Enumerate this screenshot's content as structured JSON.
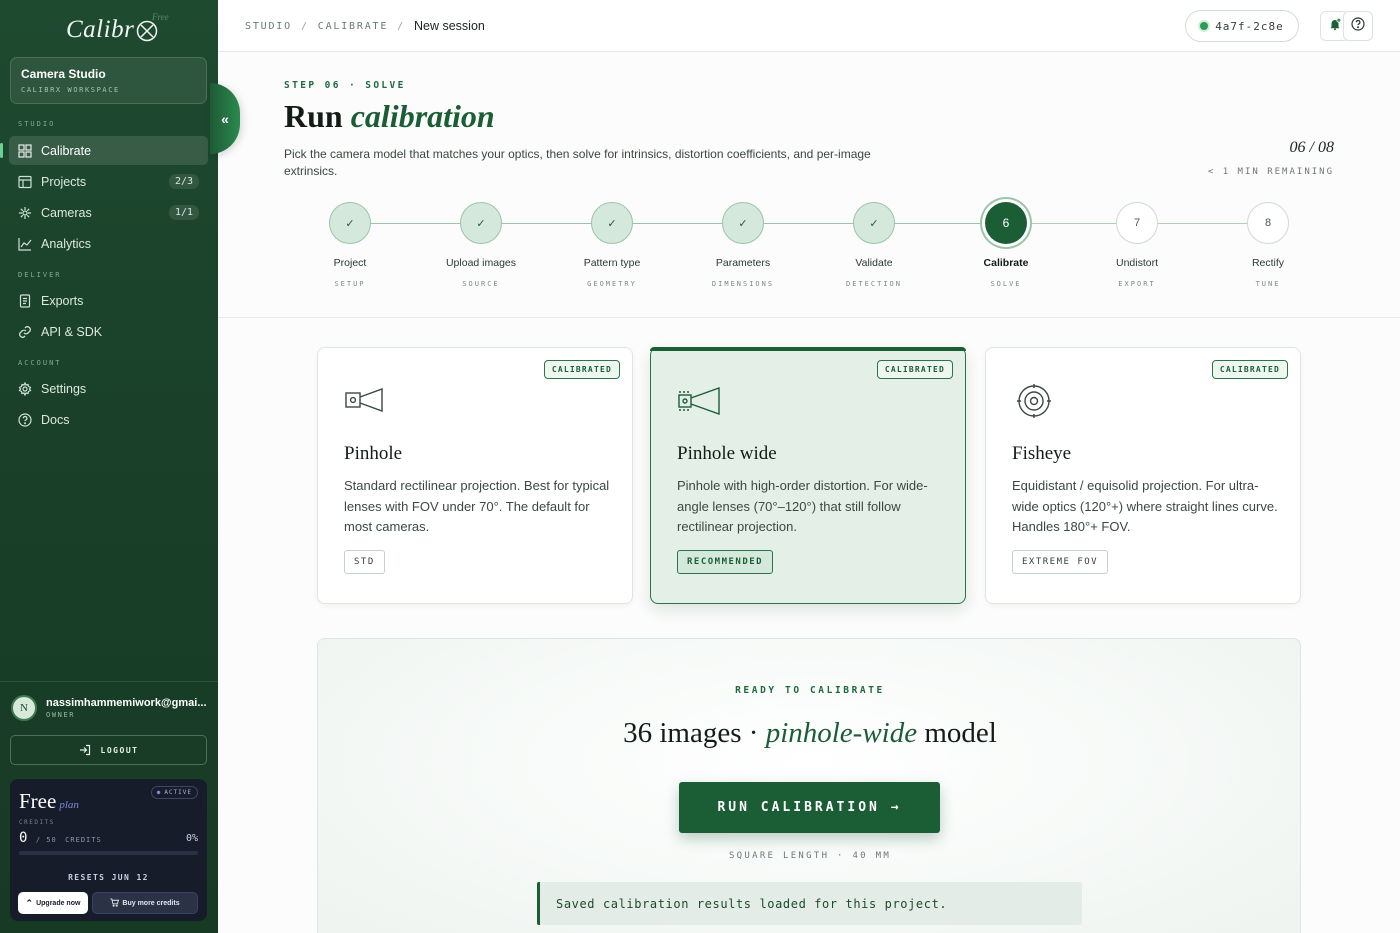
{
  "sidebar": {
    "logo": "Calibr",
    "logo_tag": "Free",
    "workspace": {
      "name": "Camera Studio",
      "sub": "CALIBRX WORKSPACE"
    },
    "sections": {
      "studio": "STUDIO",
      "deliver": "DELIVER",
      "account": "ACCOUNT"
    },
    "items": [
      {
        "label": "Calibrate",
        "icon": "grid-icon",
        "active": true
      },
      {
        "label": "Projects",
        "icon": "table-icon",
        "count": "2/3"
      },
      {
        "label": "Cameras",
        "icon": "aperture-icon",
        "count": "1/1"
      },
      {
        "label": "Analytics",
        "icon": "chart-icon"
      },
      {
        "label": "Exports",
        "icon": "document-icon"
      },
      {
        "label": "API & SDK",
        "icon": "link-icon"
      },
      {
        "label": "Settings",
        "icon": "gear-icon"
      },
      {
        "label": "Docs",
        "icon": "help-icon"
      }
    ],
    "user": {
      "initial": "N",
      "email": "nassimhammemiwork@gmai...",
      "role": "OWNER"
    },
    "logout": "LOGOUT",
    "plan": {
      "title": "Free",
      "title_suffix": "plan",
      "status": "ACTIVE",
      "credits_label": "CREDITS",
      "credits_used": "0",
      "credits_total": "/ 50",
      "credits_unit": "CREDITS",
      "percent": "0%",
      "usage_fraction": 0,
      "resets": "RESETS JUN 12",
      "upgrade": "Upgrade now",
      "buy": "Buy more credits"
    }
  },
  "topbar": {
    "crumbs": [
      "STUDIO",
      "CALIBRATE",
      "New session"
    ],
    "session_id": "4a7f-2c8e"
  },
  "header": {
    "step_label": "STEP 06 · SOLVE",
    "title_plain": "Run ",
    "title_italic": "calibration",
    "description": "Pick the camera model that matches your optics, then solve for intrinsics, distortion coefficients, and per-image extrinsics.",
    "progress": "06 / 08",
    "remaining": "< 1 MIN REMAINING"
  },
  "steps": [
    {
      "num": "✓",
      "label": "Project",
      "sub": "SETUP",
      "state": "done"
    },
    {
      "num": "✓",
      "label": "Upload images",
      "sub": "SOURCE",
      "state": "done"
    },
    {
      "num": "✓",
      "label": "Pattern type",
      "sub": "GEOMETRY",
      "state": "done"
    },
    {
      "num": "✓",
      "label": "Parameters",
      "sub": "DIMENSIONS",
      "state": "done"
    },
    {
      "num": "✓",
      "label": "Validate",
      "sub": "DETECTION",
      "state": "done"
    },
    {
      "num": "6",
      "label": "Calibrate",
      "sub": "SOLVE",
      "state": "current"
    },
    {
      "num": "7",
      "label": "Undistort",
      "sub": "EXPORT",
      "state": "todo"
    },
    {
      "num": "8",
      "label": "Rectify",
      "sub": "TUNE",
      "state": "todo"
    }
  ],
  "models": [
    {
      "name": "Pinhole",
      "badge": "CALIBRATED",
      "desc": "Standard rectilinear projection. Best for typical lenses with FOV under 70°. The default for most cameras.",
      "tag": "STD",
      "icon": "pinhole-camera-icon"
    },
    {
      "name": "Pinhole wide",
      "badge": "CALIBRATED",
      "desc": "Pinhole with high-order distortion. For wide-angle lenses (70°–120°) that still follow rectilinear projection.",
      "tag": "RECOMMENDED",
      "icon": "wide-camera-icon",
      "selected": true
    },
    {
      "name": "Fisheye",
      "badge": "CALIBRATED",
      "desc": "Equidistant / equisolid projection. For ultra-wide optics (120°+) where straight lines curve. Handles 180°+ FOV.",
      "tag": "EXTREME FOV",
      "icon": "fisheye-lens-icon"
    }
  ],
  "run": {
    "ready": "READY TO CALIBRATE",
    "title_a": "36 images · ",
    "title_italic": "pinhole-wide",
    "title_b": " model",
    "button": "RUN CALIBRATION →",
    "square": "SQUARE LENGTH · 40 MM",
    "notice": "Saved calibration results loaded for this project."
  },
  "colors": {
    "accent": "#1b5e36",
    "sidebar": "#1a4029",
    "plan_bg": "#171c2a"
  }
}
